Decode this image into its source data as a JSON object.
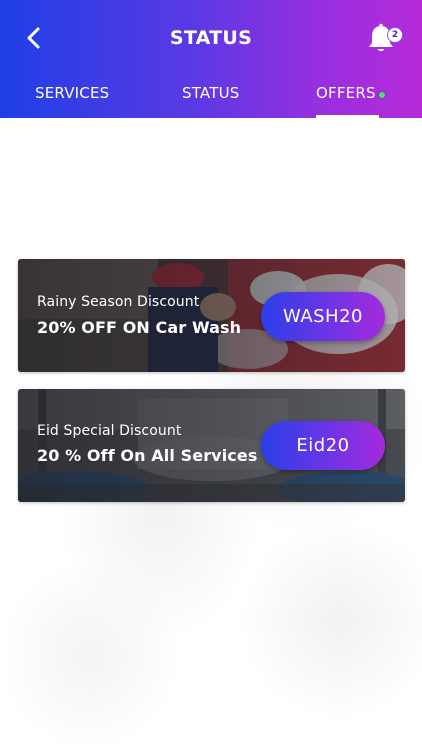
{
  "header": {
    "title": "STATUS",
    "notification_count": "2",
    "icons": {
      "back": "chevron-left-icon",
      "notifications": "bell-icon"
    },
    "colors": {
      "gradient_start": "#1f3fe6",
      "gradient_end": "#b62ad8"
    }
  },
  "tabs": [
    {
      "label": "SERVICES",
      "active": false
    },
    {
      "label": "STATUS",
      "active": false
    },
    {
      "label": "OFFERS",
      "active": true
    }
  ],
  "offers": [
    {
      "subtitle": "Rainy Season Discount",
      "title": "20% OFF ON Car Wash",
      "code": "WASH20"
    },
    {
      "subtitle": "Eid Special Discount",
      "title": "20 % Off On All Services",
      "code": "Eid20"
    }
  ]
}
